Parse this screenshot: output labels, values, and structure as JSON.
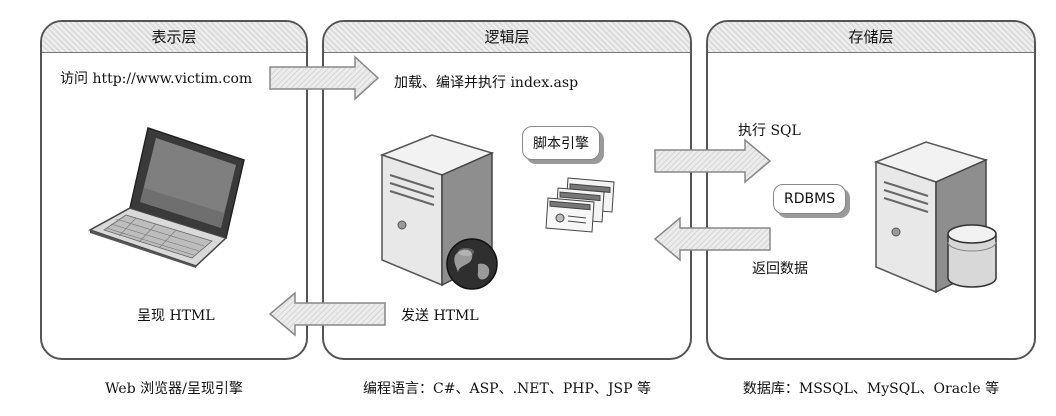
{
  "panels": {
    "presentation": "表示层",
    "logic": "逻辑层",
    "storage": "存储层"
  },
  "labels": {
    "visit": "访问 http://www.victim.com",
    "load": "加载、编译并执行 index.asp",
    "script_engine": "脚本引擎",
    "exec_sql": "执行 SQL",
    "rdbms": "RDBMS",
    "return_data": "返回数据",
    "send_html": "发送 HTML",
    "render_html": "呈现 HTML"
  },
  "captions": {
    "presentation": "Web 浏览器/呈现引擎",
    "logic": "编程语言：C#、ASP、.NET、PHP、JSP 等",
    "storage": "数据库：MSSQL、MySQL、Oracle 等"
  },
  "icons": [
    "laptop-icon",
    "server-icon",
    "globe-icon",
    "documents-icon",
    "database-icon"
  ],
  "colors": {
    "arrow_fill": "#e2e2e2",
    "arrow_stroke": "#888888",
    "border": "#555555"
  }
}
